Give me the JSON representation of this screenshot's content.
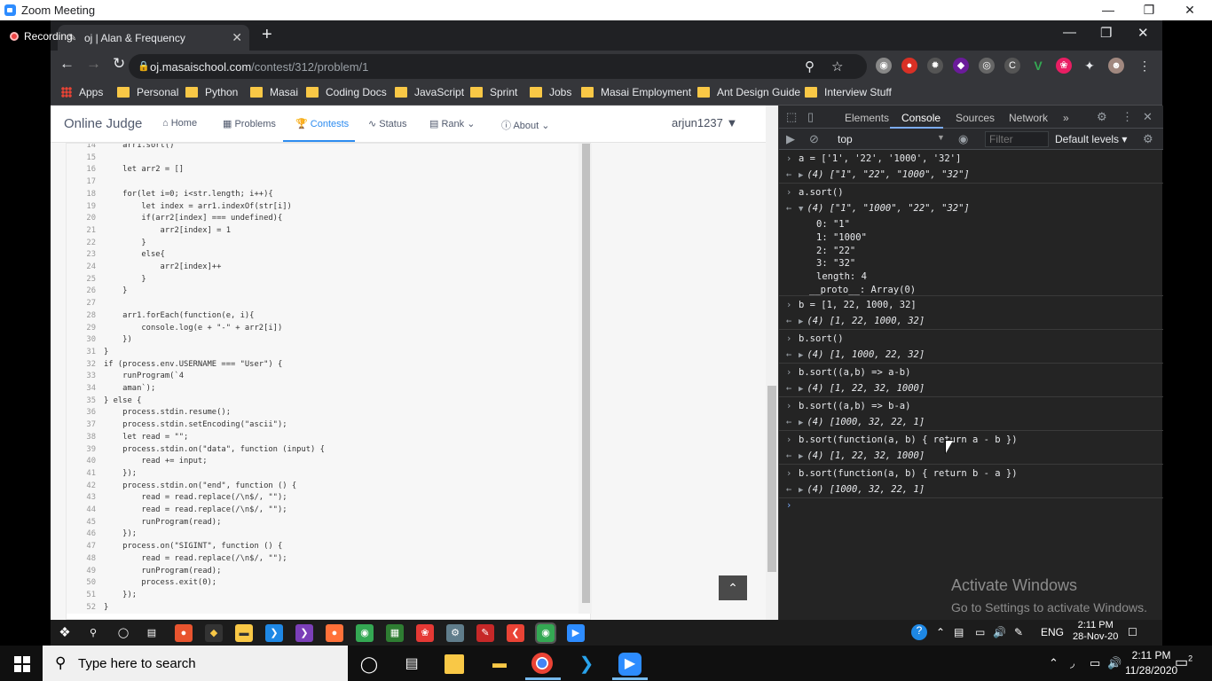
{
  "zoom": {
    "title": "Zoom Meeting",
    "recording_label": "Recording"
  },
  "browser": {
    "tab_title": "oj | Alan & Frequency",
    "url_host": "oj.masaischool.com",
    "url_path": "/contest/312/problem/1",
    "bookmarks": [
      "Apps",
      "Personal",
      "Python",
      "Masai",
      "Coding Docs",
      "JavaScript",
      "Sprint",
      "Jobs",
      "Masai Employment",
      "Ant Design Guide",
      "Interview Stuff"
    ]
  },
  "oj": {
    "brand": "Online Judge",
    "nav": [
      "Home",
      "Problems",
      "Contests",
      "Status",
      "Rank",
      "About"
    ],
    "user": "arjun1237"
  },
  "code_lines": [
    {
      "n": "14",
      "t": "    arr1.sort()"
    },
    {
      "n": "15",
      "t": ""
    },
    {
      "n": "16",
      "t": "    let arr2 = []"
    },
    {
      "n": "17",
      "t": ""
    },
    {
      "n": "18",
      "t": "    for(let i=0; i<str.length; i++){"
    },
    {
      "n": "19",
      "t": "        let index = arr1.indexOf(str[i])"
    },
    {
      "n": "20",
      "t": "        if(arr2[index] === undefined){"
    },
    {
      "n": "21",
      "t": "            arr2[index] = 1"
    },
    {
      "n": "22",
      "t": "        }"
    },
    {
      "n": "23",
      "t": "        else{"
    },
    {
      "n": "24",
      "t": "            arr2[index]++"
    },
    {
      "n": "25",
      "t": "        }"
    },
    {
      "n": "26",
      "t": "    }"
    },
    {
      "n": "27",
      "t": ""
    },
    {
      "n": "28",
      "t": "    arr1.forEach(function(e, i){"
    },
    {
      "n": "29",
      "t": "        console.log(e + \"-\" + arr2[i])"
    },
    {
      "n": "30",
      "t": "    })"
    },
    {
      "n": "31",
      "t": "}"
    },
    {
      "n": "32",
      "t": "if (process.env.USERNAME === \"User\") {"
    },
    {
      "n": "33",
      "t": "    runProgram(`4"
    },
    {
      "n": "34",
      "t": "    aman`);"
    },
    {
      "n": "35",
      "t": "} else {"
    },
    {
      "n": "36",
      "t": "    process.stdin.resume();"
    },
    {
      "n": "37",
      "t": "    process.stdin.setEncoding(\"ascii\");"
    },
    {
      "n": "38",
      "t": "    let read = \"\";"
    },
    {
      "n": "39",
      "t": "    process.stdin.on(\"data\", function (input) {"
    },
    {
      "n": "40",
      "t": "        read += input;"
    },
    {
      "n": "41",
      "t": "    });"
    },
    {
      "n": "42",
      "t": "    process.stdin.on(\"end\", function () {"
    },
    {
      "n": "43",
      "t": "        read = read.replace(/\\n$/, \"\");"
    },
    {
      "n": "44",
      "t": "        read = read.replace(/\\n$/, \"\");"
    },
    {
      "n": "45",
      "t": "        runProgram(read);"
    },
    {
      "n": "46",
      "t": "    });"
    },
    {
      "n": "47",
      "t": "    process.on(\"SIGINT\", function () {"
    },
    {
      "n": "48",
      "t": "        read = read.replace(/\\n$/, \"\");"
    },
    {
      "n": "49",
      "t": "        runProgram(read);"
    },
    {
      "n": "50",
      "t": "        process.exit(0);"
    },
    {
      "n": "51",
      "t": "    });"
    },
    {
      "n": "52",
      "t": "}"
    }
  ],
  "devtools": {
    "tabs": [
      "Elements",
      "Console",
      "Sources",
      "Network"
    ],
    "context": "top",
    "filter_placeholder": "Filter",
    "levels": "Default levels",
    "entries": [
      {
        "in": "a = ['1', '22', '1000', '32']",
        "out": "(4) [\"1\", \"22\", \"1000\", \"32\"]"
      },
      {
        "in": "a.sort()",
        "out": "(4) [\"1\", \"1000\", \"22\", \"32\"]",
        "expanded": true,
        "props": [
          "0: \"1\"",
          "1: \"1000\"",
          "2: \"22\"",
          "3: \"32\"",
          "length: 4",
          "__proto__: Array(0)"
        ]
      },
      {
        "in": "b = [1, 22, 1000, 32]",
        "out": "(4) [1, 22, 1000, 32]"
      },
      {
        "in": "b.sort()",
        "out": "(4) [1, 1000, 22, 32]"
      },
      {
        "in": "b.sort((a,b) => a-b)",
        "out": "(4) [1, 22, 32, 1000]"
      },
      {
        "in": "b.sort((a,b) => b-a)",
        "out": "(4) [1000, 32, 22, 1]"
      },
      {
        "in": "b.sort(function(a, b) { return a - b })",
        "out": "(4) [1, 22, 32, 1000]"
      },
      {
        "in": "b.sort(function(a, b) { return b - a })",
        "out": "(4) [1000, 32, 22, 1]"
      }
    ]
  },
  "activate": {
    "title": "Activate Windows",
    "subtitle": "Go to Settings to activate Windows."
  },
  "inner_taskbar": {
    "lang": "ENG",
    "time": "2:11 PM",
    "date": "28-Nov-20"
  },
  "taskbar": {
    "search_placeholder": "Type here to search",
    "time": "2:11 PM",
    "date": "11/28/2020",
    "notifications": "2"
  }
}
